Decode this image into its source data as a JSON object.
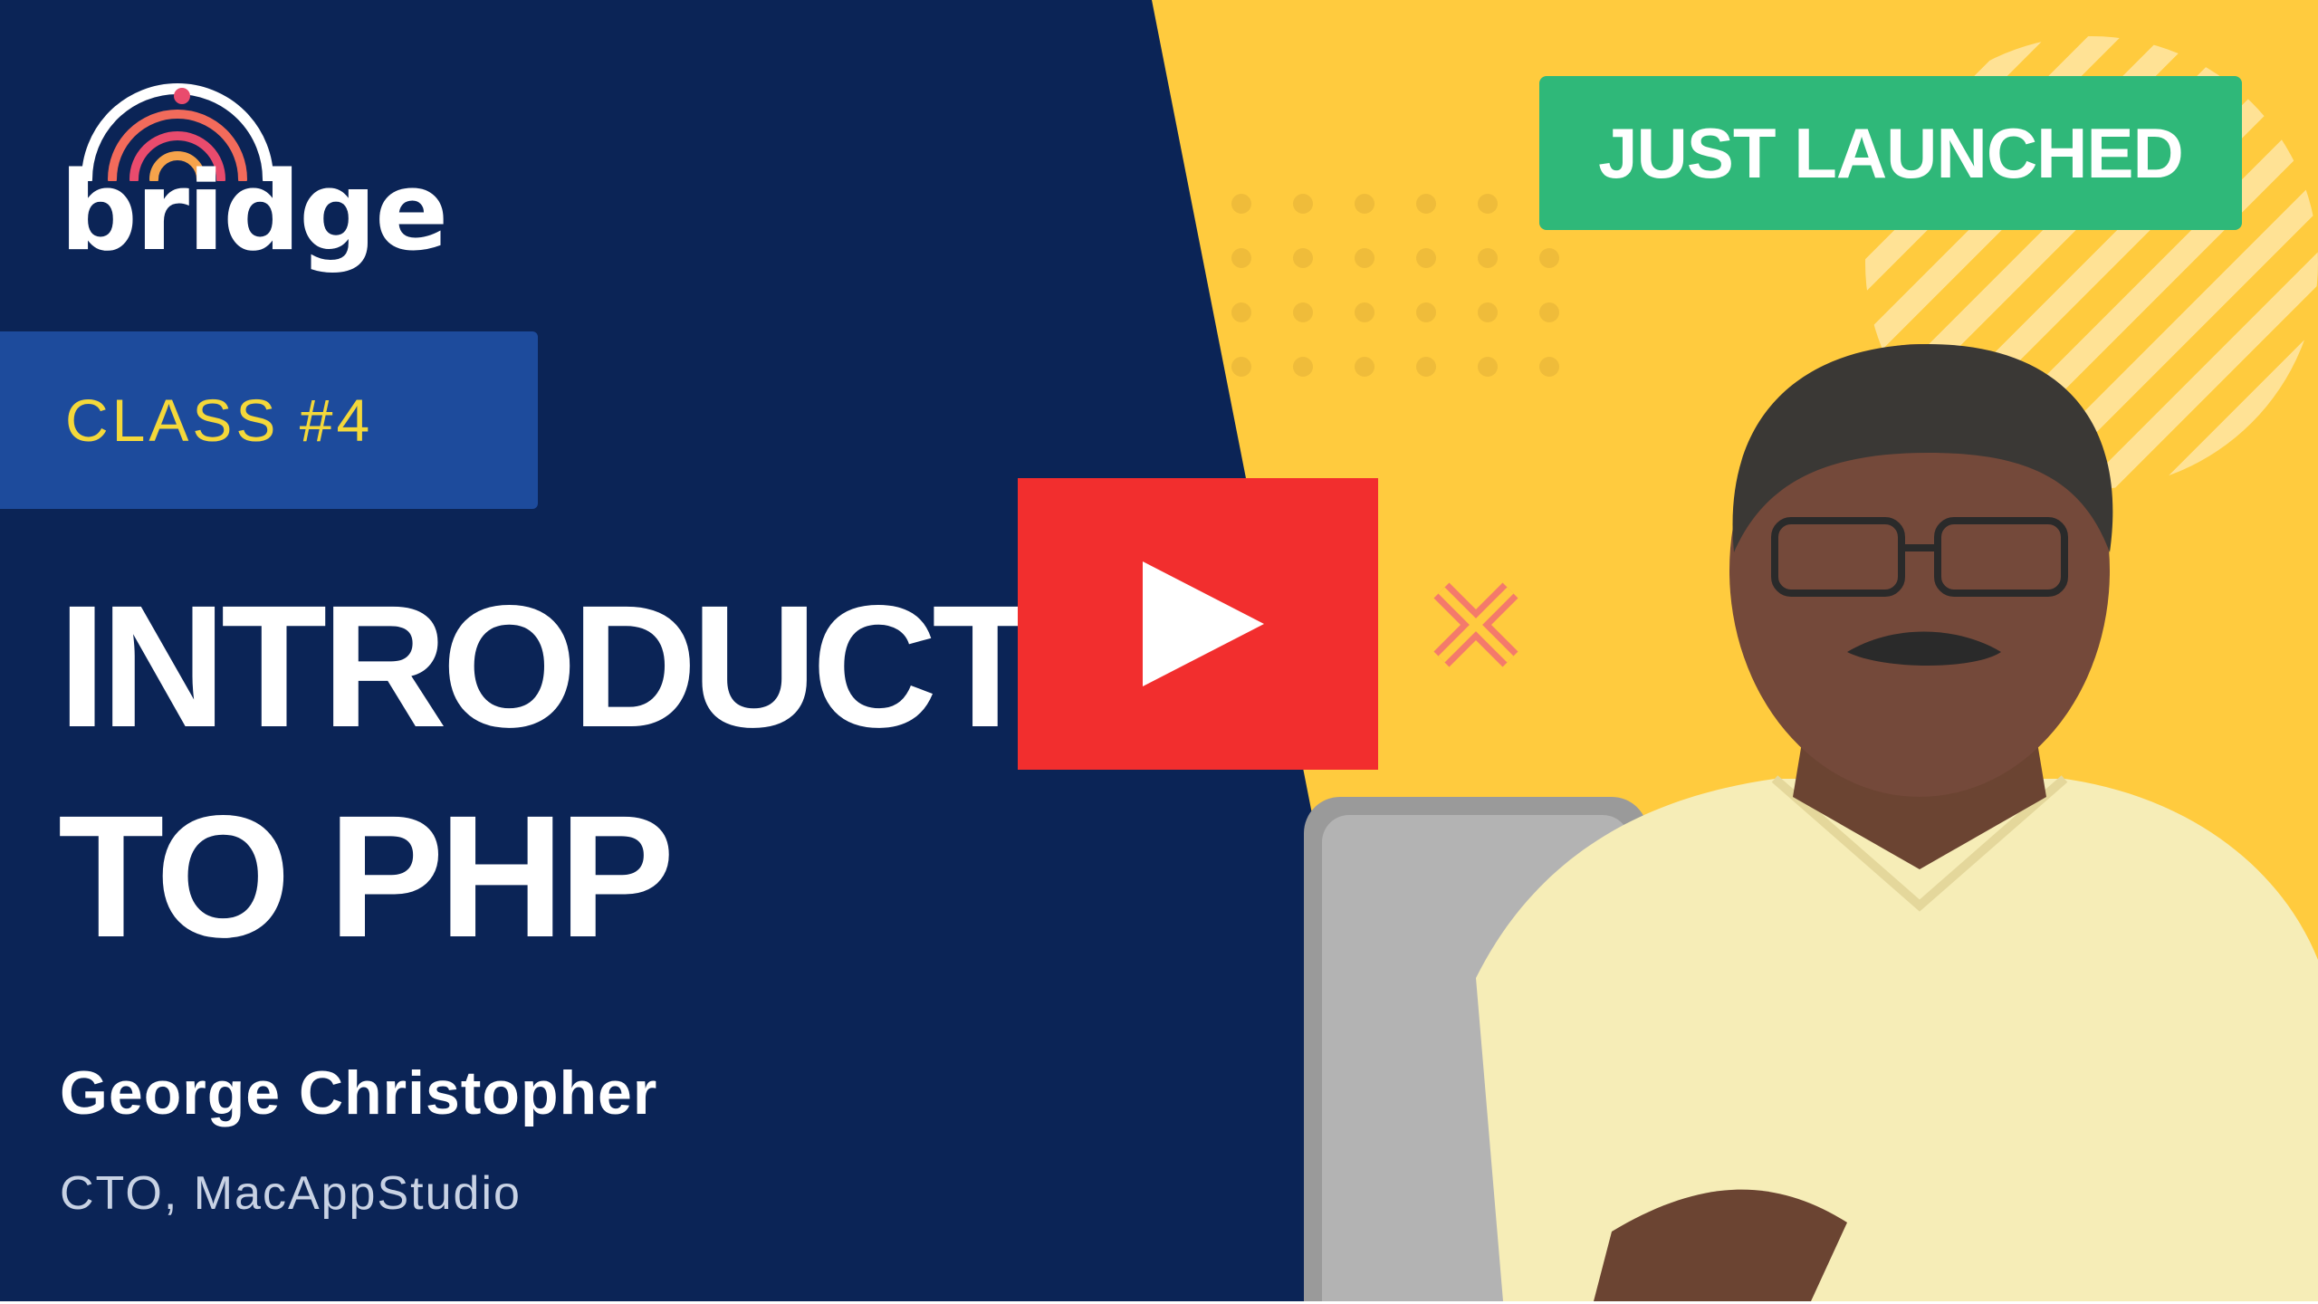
{
  "logo": {
    "text": "bridge",
    "colors": [
      "#F26B5B",
      "#E94B6D",
      "#F6A34B"
    ]
  },
  "class_badge": {
    "label": "CLASS #4"
  },
  "title": {
    "line1": "INTRODUCT",
    "line2": "TO PHP"
  },
  "presenter": {
    "name": "George Christopher",
    "role": "CTO, MacAppStudio"
  },
  "launch_badge": {
    "label": "JUST LAUNCHED"
  },
  "play_button": {
    "icon": "play-icon",
    "color": "#F22E2E"
  },
  "colors": {
    "navy": "#0B2456",
    "yellow": "#FFCB3E",
    "green": "#2FB879",
    "badge_blue": "#1D4B9C",
    "accent_yellow": "#F4D83A",
    "x_mark": "#F47A6B"
  }
}
